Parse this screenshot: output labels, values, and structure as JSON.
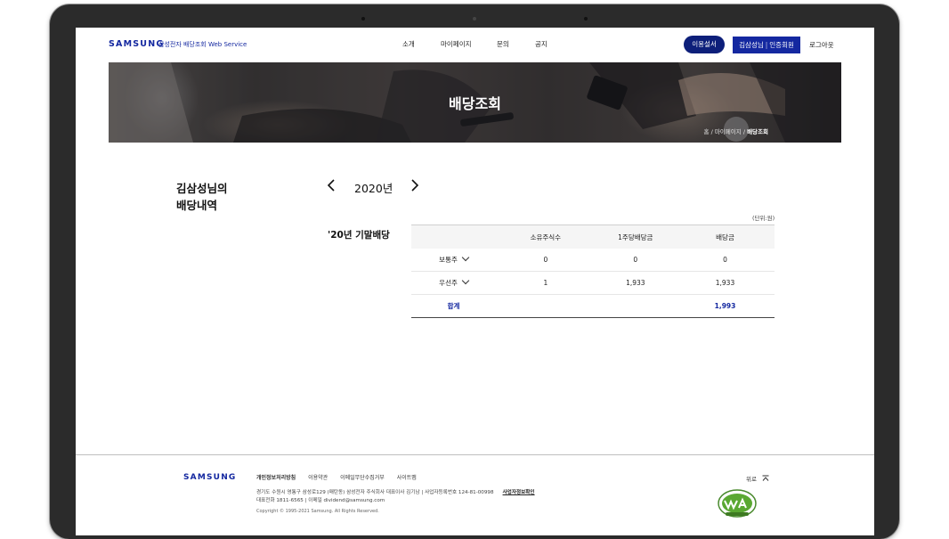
{
  "header": {
    "logo": "SAMSUNG",
    "service_name": "삼성전자 배당조회 Web Service",
    "nav": [
      "소개",
      "마이페이지",
      "문의",
      "공지"
    ],
    "btn_manual": "이용설서",
    "btn_user_name": "김삼성님",
    "btn_user_status": "인증회원",
    "btn_logout": "로그아웃"
  },
  "banner": {
    "title": "배당조회",
    "breadcrumb": [
      "홈",
      "마이페이지",
      "배당조회"
    ]
  },
  "main": {
    "owner_line1": "김삼성님의",
    "owner_line2": "배당내역",
    "year": "2020년",
    "section_title": "'20년 기말배당",
    "unit": "(단위:원)",
    "columns": [
      "",
      "소유주식수",
      "1주당배당금",
      "배당금"
    ],
    "rows": [
      {
        "type": "보통주",
        "shares": "0",
        "per_share": "0",
        "dividend": "0"
      },
      {
        "type": "우선주",
        "shares": "1",
        "per_share": "1,933",
        "dividend": "1,933"
      }
    ],
    "total": {
      "label": "합계",
      "dividend": "1,993"
    }
  },
  "footer": {
    "logo": "SAMSUNG",
    "links": [
      "개인정보처리방침",
      "이용약관",
      "이메일무단수집거부",
      "사이트맵"
    ],
    "address": "경기도 수원시 영통구 삼성로129 (매탄동) 삼성전자 주식회사 대표이사 김기남 | 사업자등록번호 124-81-00998",
    "biz_info": "사업자정보확인",
    "contact": "대표전화 1811-6565 | 이메일 dividend@samsung.com",
    "copyright": "Copyright © 1995-2021 Samsung. All Rights Reserved.",
    "top_label": "위로",
    "badge_icon": "web-accessibility-certification-mark"
  }
}
